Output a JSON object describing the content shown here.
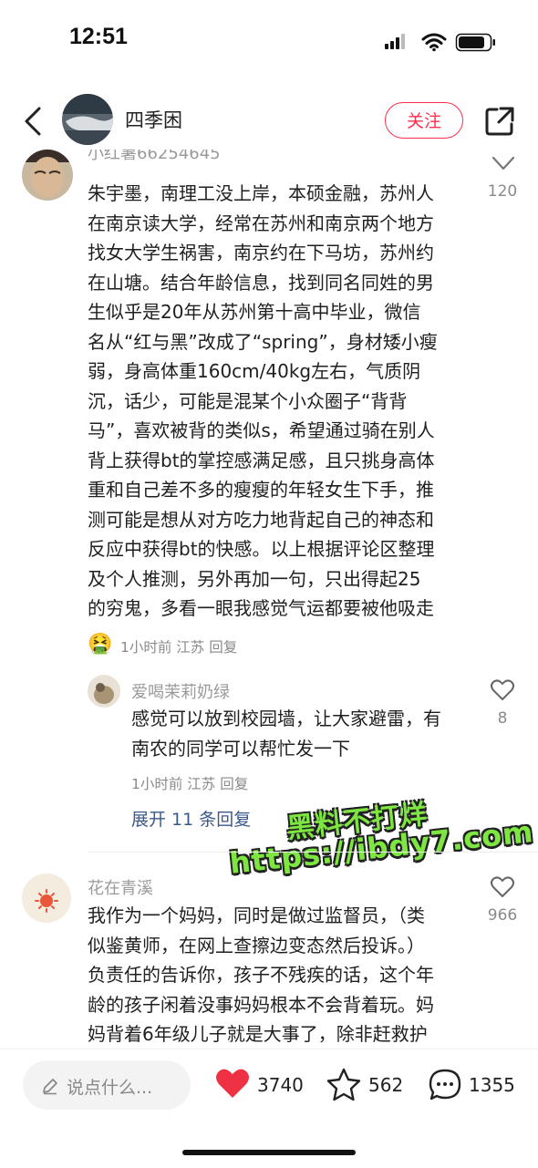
{
  "status_bar": {
    "time": "12:51"
  },
  "header": {
    "username": "四季困",
    "follow_label": "关注"
  },
  "comments": [
    {
      "name": "小红薯66254645",
      "likes": "120",
      "lines": [
        "朱宇墨，南理工没上岸，本硕金融，苏州人",
        "在南京读大学，经常在苏州和南京两个地方",
        "找女大学生祸害，南京约在下马坊，苏州约",
        "在山塘。结合年龄信息，找到同名同姓的男",
        "生似乎是20年从苏州第十高中毕业，微信",
        "名从“红与黑”改成了“spring”，身材矮小瘦",
        "弱，身高体重160cm/40kg左右，气质阴",
        "沉，话少，可能是混某个小众圈子“背背",
        "马”，喜欢被背的类似s，希望通过骑在别人",
        "背上获得bt的掌控感满足感，且只挑身高体",
        "重和自己差不多的瘦瘦的年轻女生下手，推",
        "测可能是想从对方吃力地背起自己的神态和",
        "反应中获得bt的快感。以上根据评论区整理",
        "及个人推测，另外再加一句，只出得起25",
        "的穷鬼，多看一眼我感觉气运都要被他吸走"
      ],
      "emoji": "🤮",
      "meta": "1小时前 江苏 回复"
    },
    {
      "name": "爱喝茉莉奶绿",
      "likes": "8",
      "lines": [
        "感觉可以放到校园墙，让大家避雷，有",
        "南农的同学可以帮忙发一下"
      ],
      "meta": "1小时前 江苏 回复",
      "expand": "展开 11 条回复"
    },
    {
      "name": "花在青溪",
      "likes": "966",
      "lines": [
        "我作为一个妈妈，同时是做过监督员，（类",
        "似鉴黄师，在网上查擦边变态然后投诉。）",
        "负责任的告诉你，孩子不残疾的话，这个年",
        "龄的孩子闲着没事妈妈根本不会背着玩。妈",
        "妈背着6年级儿子就是大事了，除非赶救护"
      ]
    }
  ],
  "watermark": {
    "line1": "黑料不打烊",
    "line2": "https://ibdy7.com"
  },
  "bottom_bar": {
    "input_placeholder": "说点什么...",
    "likes": "3740",
    "stars": "562",
    "comments": "1355"
  },
  "colors": {
    "accent": "#ff2e4d",
    "link": "#3b5a8a",
    "heart": "#ee3244"
  }
}
